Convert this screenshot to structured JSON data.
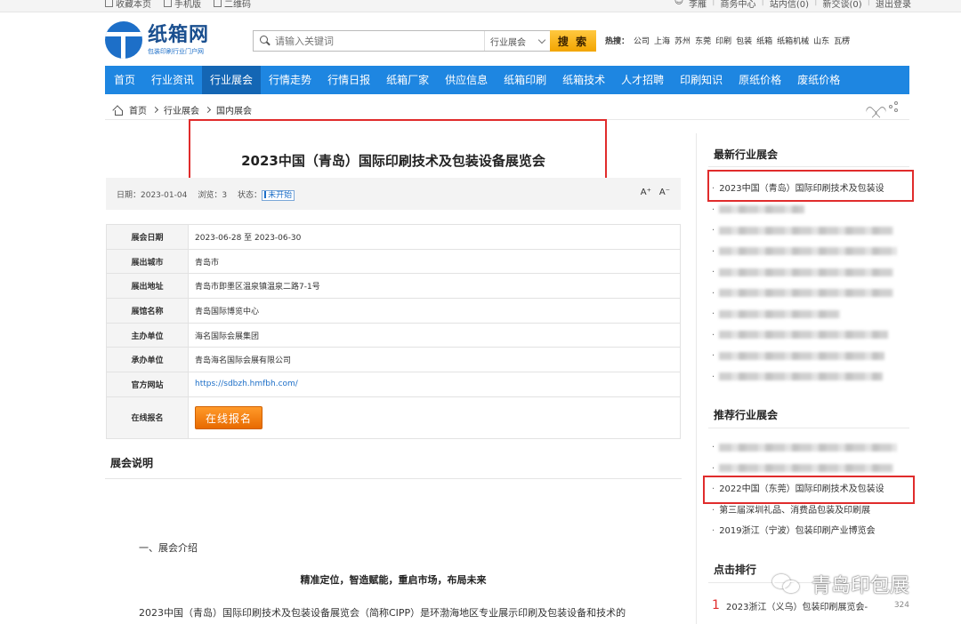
{
  "topbar": {
    "left": [
      "收藏本页",
      "手机版",
      "二维码"
    ],
    "right": [
      "李雁",
      "商务中心",
      "站内信(0)",
      "新交谈(0)",
      "退出登录"
    ]
  },
  "logo": {
    "title": "纸箱网",
    "subtitle": "包装印刷行业门户网"
  },
  "search": {
    "placeholder": "请输入关键词",
    "category": "行业展会",
    "button": "搜 索"
  },
  "hot": {
    "label": "热搜：",
    "terms": [
      "公司",
      "上海",
      "苏州",
      "东莞",
      "印刷",
      "包装",
      "纸箱",
      "纸箱机械",
      "山东",
      "瓦楞"
    ]
  },
  "nav": [
    "首页",
    "行业资讯",
    "行业展会",
    "行情走势",
    "行情日报",
    "纸箱厂家",
    "供应信息",
    "纸箱印刷",
    "纸箱技术",
    "人才招聘",
    "印刷知识",
    "原纸价格",
    "废纸价格"
  ],
  "nav_active": "行业展会",
  "breadcrumb": [
    "首页",
    "行业展会",
    "国内展会"
  ],
  "article": {
    "title": "2023中国（青岛）国际印刷技术及包装设备展览会",
    "date": "日期：2023-01-04",
    "views": "浏览：3",
    "status_label": "状态：",
    "status": "未开始",
    "font_up": "A⁺",
    "font_down": "A⁻"
  },
  "info": [
    {
      "k": "展会日期",
      "v": "2023-06-28 至 2023-06-30"
    },
    {
      "k": "展出城市",
      "v": "青岛市"
    },
    {
      "k": "展出地址",
      "v": "青岛市即墨区温泉镇温泉二路7-1号"
    },
    {
      "k": "展馆名称",
      "v": "青岛国际博览中心"
    },
    {
      "k": "主办单位",
      "v": "海名国际会展集团"
    },
    {
      "k": "承办单位",
      "v": "青岛海名国际会展有限公司"
    },
    {
      "k": "官方网站",
      "v": "https://sdbzh.hmfbh.com/"
    },
    {
      "k": "在线报名",
      "v": "在线报名"
    }
  ],
  "content": {
    "section_title": "展会说明",
    "intro_heading": "一、展会介绍",
    "slogan": "精准定位，智造赋能，重启市场，布局未来",
    "paragraph": "2023中国（青岛）国际印刷技术及包装设备展览会（简称CIPP）是环渤海地区专业展示印刷及包装设备和技术的"
  },
  "sidebar": {
    "latest_title": "最新行业展会",
    "latest_first": "2023中国（青岛）国际印刷技术及包装设",
    "recommend_title": "推荐行业展会",
    "recommend": [
      "2022中国（东莞）国际印刷技术及包装设",
      "第三届深圳礼品、消费品包装及印刷展",
      "2019浙江（宁波）包装印刷产业博览会"
    ],
    "rank_title": "点击排行",
    "rank": [
      {
        "num": "1",
        "name": "2023浙江（义乌）包装印刷展览会-",
        "count": "324"
      }
    ]
  },
  "watermark": "青岛印包展",
  "colors": {
    "nav": "#1e86e1",
    "nav_active": "#1466b4",
    "highlight": "#e02c2c",
    "button": "#f08000"
  }
}
